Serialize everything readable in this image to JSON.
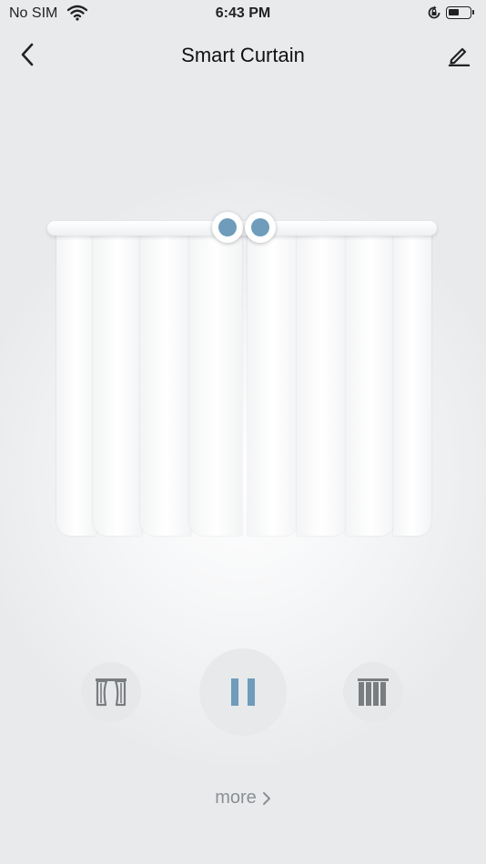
{
  "status_bar": {
    "carrier": "No SIM",
    "time": "6:43 PM"
  },
  "nav": {
    "title": "Smart Curtain"
  },
  "curtain": {
    "state": "closed",
    "accent_color": "#6e9cba"
  },
  "controls": {
    "open_icon": "curtain-open-icon",
    "pause_icon": "pause-icon",
    "close_icon": "curtain-close-icon"
  },
  "more": {
    "label": "more"
  }
}
